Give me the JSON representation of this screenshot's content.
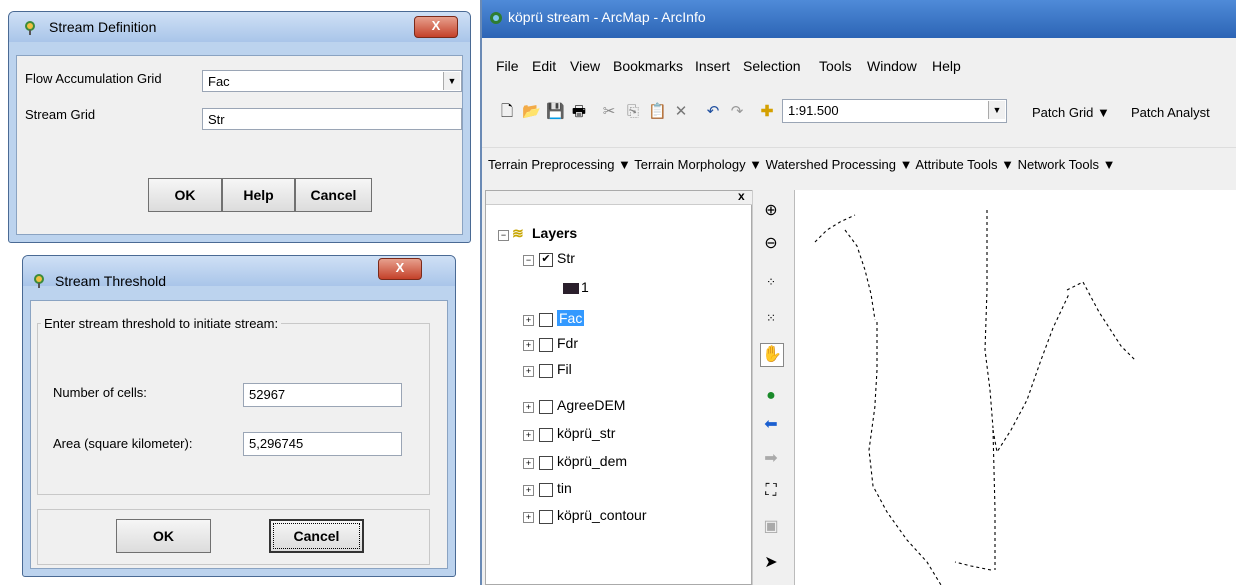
{
  "stream_definition": {
    "title": "Stream Definition",
    "flow_label": "Flow Accumulation Grid",
    "flow_value": "Fac",
    "stream_label": "Stream Grid",
    "stream_value": "Str",
    "ok": "OK",
    "help": "Help",
    "cancel": "Cancel",
    "close": "X"
  },
  "stream_threshold": {
    "title": "Stream Threshold",
    "group_label": "Enter stream threshold to initiate stream:",
    "cells_label": "Number of cells:",
    "cells_value": "52967",
    "area_label": "Area (square kilometer):",
    "area_value": "5,296745",
    "ok": "OK",
    "cancel": "Cancel",
    "close": "X"
  },
  "arcmap": {
    "title": "köprü stream - ArcMap - ArcInfo",
    "menu": [
      "File",
      "Edit",
      "View",
      "Bookmarks",
      "Insert",
      "Selection",
      "Tools",
      "Window",
      "Help"
    ],
    "scale": "1:91.500",
    "patch_grid": "Patch Grid ▼",
    "patch_analyst": "Patch Analyst",
    "hydro_toolbar": "Terrain Preprocessing ▼ Terrain Morphology ▼ Watershed Processing ▼ Attribute Tools ▼ Network Tools ▼",
    "toc_close": "x",
    "layers_title": "Layers",
    "layers": [
      {
        "name": "Str",
        "checked": true,
        "expanded": true
      },
      {
        "name": "Fac",
        "checked": false,
        "selected": true
      },
      {
        "name": "Fdr",
        "checked": false
      },
      {
        "name": "Fil",
        "checked": false
      },
      {
        "name": "AgreeDEM",
        "checked": false
      },
      {
        "name": "köprü_str",
        "checked": false
      },
      {
        "name": "köprü_dem",
        "checked": false
      },
      {
        "name": "tin",
        "checked": false
      },
      {
        "name": "köprü_contour",
        "checked": false
      }
    ],
    "str_legend_value": "1",
    "colors": {
      "title_bar": "#2c64b5",
      "selection": "#3399ff"
    }
  }
}
